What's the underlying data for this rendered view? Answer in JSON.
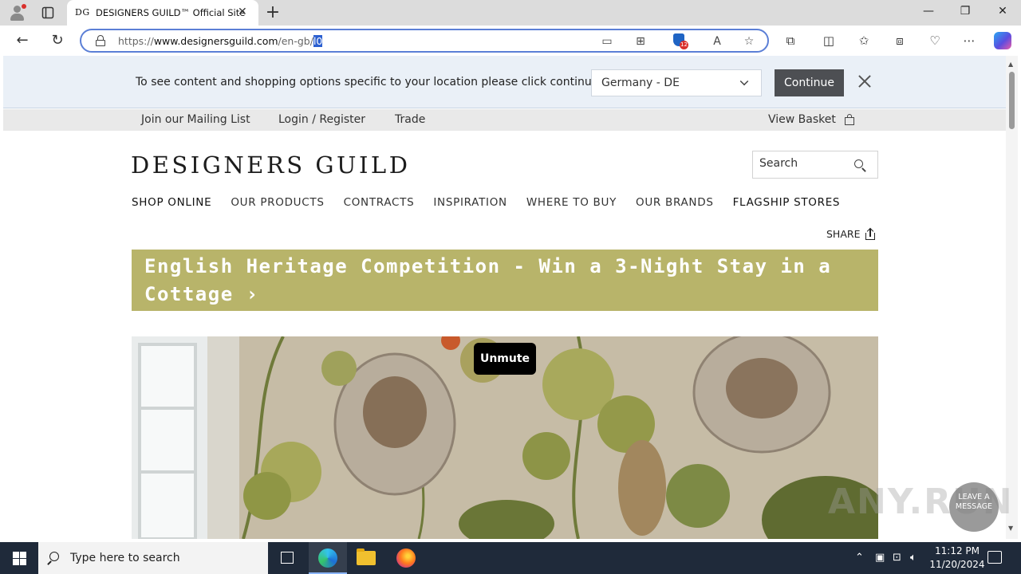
{
  "browser": {
    "tab": {
      "favicon_text": "DG",
      "title": "DESIGNERS GUILD™ Official Site"
    },
    "address": {
      "scheme": "https://",
      "host": "www.designersguild.com",
      "path": "/en-gb/",
      "selected": "l0"
    },
    "tracker_badge_count": "12"
  },
  "location_bar": {
    "message": "To see content and shopping options specific to your location please click continue",
    "selected_country": "Germany - DE",
    "continue_label": "Continue"
  },
  "utility_nav": {
    "mailing_list": "Join our Mailing List",
    "login": "Login / Register",
    "trade": "Trade",
    "basket": "View Basket"
  },
  "header": {
    "logo": "DESIGNERS GUILD",
    "search_placeholder": "Search"
  },
  "main_nav": [
    "SHOP ONLINE",
    "OUR PRODUCTS",
    "CONTRACTS",
    "INSPIRATION",
    "WHERE TO BUY",
    "OUR BRANDS",
    "FLAGSHIP STORES"
  ],
  "share_label": "SHARE",
  "promo_banner": {
    "text": "English Heritage Competition - Win a 3-Night Stay in a Cottage ›"
  },
  "hero": {
    "unmute_label": "Unmute"
  },
  "overlay": {
    "watermark": "ANY.RUN",
    "chat_line1": "LEAVE A",
    "chat_line2": "MESSAGE"
  },
  "taskbar": {
    "search_placeholder": "Type here to search",
    "time": "11:12 PM",
    "date": "11/20/2024"
  },
  "colors": {
    "banner_bg": "#b8b46a",
    "continue_bg": "#4d4f53",
    "location_bar_bg": "#eaf0f7",
    "address_focus": "#5b7fd6"
  }
}
